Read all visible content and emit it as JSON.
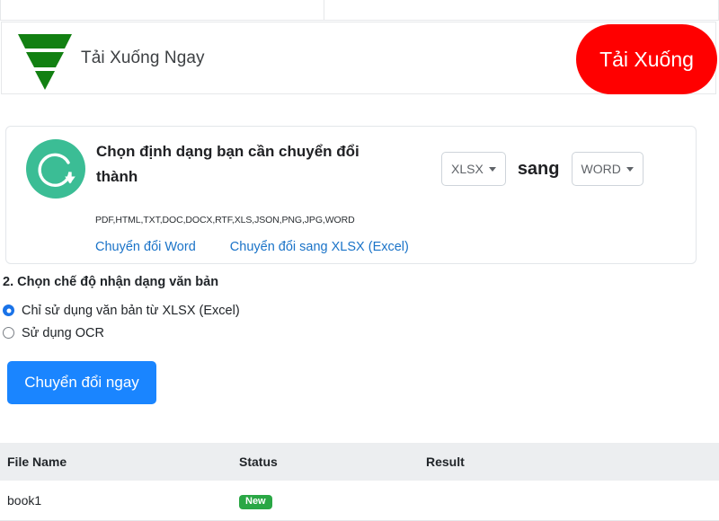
{
  "top_strip": {
    "cells": [
      "",
      "",
      ""
    ]
  },
  "banner": {
    "icon": "download-funnel-icon",
    "label": "Tải Xuống Ngay",
    "button_label": "Tải Xuống",
    "button_color": "#ff0000",
    "icon_color": "#128012"
  },
  "card": {
    "logo_icon": "convert-circle-arrow-icon",
    "logo_color": "#3bbd95",
    "title": "Chọn định dạng bạn cần chuyển đổi thành",
    "source_format": "XLSX",
    "between_label": "sang",
    "target_format": "WORD",
    "supported_formats": "PDF,HTML,TXT,DOC,DOCX,RTF,XLS,JSON,PNG,JPG,WORD",
    "links": [
      "Chuyển đổi Word",
      "Chuyển đổi sang XLSX (Excel)"
    ],
    "link_color": "#1a73c8"
  },
  "step2": {
    "heading": "2. Chọn chế độ nhận dạng văn bản",
    "options": [
      {
        "label": "Chỉ sử dụng văn bản từ XLSX (Excel)",
        "selected": true
      },
      {
        "label": "Sử dụng OCR",
        "selected": false
      }
    ],
    "accent_color": "#1a73e8"
  },
  "convert": {
    "button_label": "Chuyển đổi ngay",
    "button_color": "#1a85ff"
  },
  "results": {
    "headers": [
      "File Name",
      "Status",
      "Result"
    ],
    "rows": [
      {
        "file_name": "book1",
        "status": "New",
        "result": ""
      }
    ],
    "badge_color": "#2aa745"
  }
}
